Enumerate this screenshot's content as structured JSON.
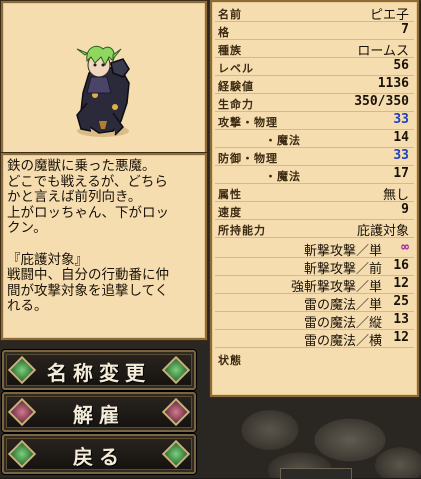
{
  "description": "鉄の魔獣に乗った悪魔。\nどこでも戦えるが、どちら\nかと言えば前列向き。\n上がロッちゃん、下がロッ\nクン。\n\n『庇護対象』\n戦闘中、自分の行動番に仲\n間が攻撃対象を追撃してく\nれる。",
  "stats": {
    "name": {
      "label": "名前",
      "value": "ピエ子"
    },
    "rank": {
      "label": "格",
      "value": "7"
    },
    "race": {
      "label": "種族",
      "value": "ロームス"
    },
    "level": {
      "label": "レベル",
      "value": "56"
    },
    "exp": {
      "label": "経験値",
      "value": "1136"
    },
    "hp": {
      "label": "生命力",
      "value": "350/350"
    },
    "atk_phys": {
      "label": "攻撃・物理",
      "value": "33"
    },
    "atk_mag": {
      "label": "・魔法",
      "value": "14"
    },
    "def_phys": {
      "label": "防御・物理",
      "value": "33"
    },
    "def_mag": {
      "label": "・魔法",
      "value": "17"
    },
    "element": {
      "label": "属性",
      "value": "無し"
    },
    "speed": {
      "label": "速度",
      "value": "9"
    },
    "ability": {
      "label": "所持能力",
      "value": "庇護対象"
    }
  },
  "skills": [
    {
      "name": "斬撃攻撃／単",
      "value": "∞"
    },
    {
      "name": "斬撃攻撃／前",
      "value": "16"
    },
    {
      "name": "強斬撃攻撃／単",
      "value": "12"
    },
    {
      "name": "雷の魔法／単",
      "value": "25"
    },
    {
      "name": "雷の魔法／縦",
      "value": "13"
    },
    {
      "name": "雷の魔法／横",
      "value": "12"
    }
  ],
  "status_label": "状態",
  "buttons": {
    "rename": "名称変更",
    "dismiss": "解雇",
    "back": "戻る"
  },
  "colors": {
    "panel": "#f5ddb0",
    "border": "#8c6a3c",
    "highlight_blue": "#1e3fc0",
    "gem_green": "#3c8c48",
    "gem_red": "#8c2a3c"
  },
  "icons": {
    "portrait": "demon-riding-beast-sprite",
    "gem": "diamond-gem-icon"
  }
}
